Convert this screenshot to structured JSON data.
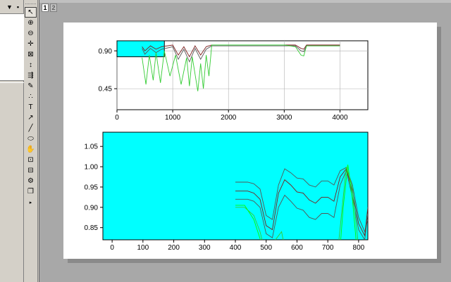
{
  "project_panel": {
    "header_icons": [
      "dropdown-icon",
      "pin-icon",
      "close-icon"
    ]
  },
  "toolbar": {
    "tools": [
      "pointer-icon",
      "zoom-in-icon",
      "zoom-out-icon",
      "screen-reader-icon",
      "data-selector-icon",
      "data-reader-icon",
      "mask-icon",
      "data-draw-icon",
      "scatter-tool-icon",
      "text-tool-icon",
      "arrow-tool-icon",
      "line-tool-icon",
      "shape-tool-icon",
      "hand-tool-icon",
      "rescale-icon",
      "region-icon",
      "settings-icon",
      "layers-icon",
      "more-icon"
    ]
  },
  "layers": [
    "1",
    "2"
  ],
  "colors": {
    "plot_fill": "#00ffff",
    "dark_red": "#7a1c1c",
    "gray_line": "#555555",
    "green_line": "#33cc33",
    "bright_green": "#00ff00"
  },
  "chart_data": [
    {
      "type": "line",
      "x_ticks": [
        "0",
        "1000",
        "2000",
        "3000",
        "4000"
      ],
      "y_ticks": [
        "0.45",
        "0.90"
      ],
      "xlim": [
        0,
        4500
      ],
      "ylim": [
        0.2,
        1.02
      ],
      "series": [
        {
          "color": "dark-red",
          "x": [
            450,
            500,
            600,
            700,
            800,
            1000,
            1100,
            1200,
            1300,
            1400,
            1500,
            1600,
            1700,
            1800,
            2000,
            2500,
            3000,
            3200,
            3300,
            3350,
            3400,
            4000
          ],
          "y": [
            0.95,
            0.9,
            0.96,
            0.92,
            0.95,
            0.97,
            0.85,
            0.95,
            0.83,
            0.96,
            0.85,
            0.95,
            0.97,
            0.97,
            0.97,
            0.97,
            0.97,
            0.97,
            0.93,
            0.92,
            0.97,
            0.97
          ]
        },
        {
          "color": "gray",
          "x": [
            450,
            500,
            600,
            700,
            800,
            1000,
            1100,
            1200,
            1300,
            1400,
            1500,
            1600,
            1700,
            1800,
            2000,
            2500,
            3000,
            3200,
            3300,
            3350,
            3400,
            4000
          ],
          "y": [
            0.93,
            0.86,
            0.93,
            0.88,
            0.92,
            0.95,
            0.8,
            0.92,
            0.77,
            0.93,
            0.8,
            0.92,
            0.96,
            0.96,
            0.96,
            0.96,
            0.96,
            0.96,
            0.9,
            0.89,
            0.96,
            0.96
          ]
        },
        {
          "color": "green",
          "x": [
            450,
            520,
            580,
            650,
            700,
            780,
            850,
            950,
            1050,
            1150,
            1250,
            1300,
            1350,
            1450,
            1500,
            1550,
            1600,
            1650,
            1700,
            1800,
            2000,
            3000,
            3200,
            3300,
            3350,
            3400,
            4000
          ],
          "y": [
            0.82,
            0.5,
            0.85,
            0.55,
            0.88,
            0.52,
            0.9,
            0.6,
            0.85,
            0.5,
            0.82,
            0.48,
            0.83,
            0.42,
            0.75,
            0.45,
            0.85,
            0.6,
            0.97,
            0.97,
            0.97,
            0.97,
            0.95,
            0.85,
            0.84,
            0.96,
            0.96
          ]
        }
      ],
      "selection_box": {
        "x": [
          0,
          850
        ],
        "y": [
          0.83,
          1.02
        ]
      }
    },
    {
      "type": "line",
      "x_ticks": [
        "0",
        "100",
        "200",
        "300",
        "400",
        "500",
        "600",
        "700",
        "800"
      ],
      "y_ticks": [
        "0.85",
        "0.90",
        "0.95",
        "1.00",
        "1.05"
      ],
      "xlim": [
        -30,
        830
      ],
      "ylim": [
        0.82,
        1.085
      ],
      "series": [
        {
          "color": "gray",
          "x": [
            400,
            440,
            460,
            480,
            500,
            520,
            540,
            560,
            580,
            600,
            620,
            640,
            660,
            680,
            700,
            720,
            740,
            760,
            780,
            800,
            820,
            830
          ],
          "y": [
            0.962,
            0.962,
            0.958,
            0.945,
            0.88,
            0.87,
            0.955,
            0.995,
            0.985,
            0.972,
            0.97,
            0.955,
            0.95,
            0.965,
            0.965,
            0.955,
            0.99,
            0.998,
            0.955,
            0.875,
            0.84,
            0.87
          ]
        },
        {
          "color": "dark-red",
          "x": [
            400,
            440,
            460,
            480,
            500,
            520,
            540,
            560,
            580,
            600,
            620,
            640,
            660,
            680,
            700,
            720,
            740,
            760,
            780,
            800,
            820,
            830
          ],
          "y": [
            0.94,
            0.94,
            0.935,
            0.92,
            0.855,
            0.845,
            0.935,
            0.968,
            0.955,
            0.938,
            0.935,
            0.918,
            0.91,
            0.925,
            0.925,
            0.915,
            0.975,
            0.995,
            0.94,
            0.86,
            0.83,
            0.9
          ]
        },
        {
          "color": "gray",
          "x": [
            400,
            440,
            460,
            480,
            500,
            520,
            540,
            560,
            580,
            600,
            620,
            640,
            660,
            680,
            700,
            720,
            740,
            760,
            780,
            800,
            820,
            830
          ],
          "y": [
            0.92,
            0.92,
            0.915,
            0.9,
            0.835,
            0.825,
            0.9,
            0.93,
            0.915,
            0.898,
            0.893,
            0.875,
            0.87,
            0.885,
            0.885,
            0.875,
            0.955,
            0.99,
            0.925,
            0.845,
            0.82,
            0.885
          ]
        },
        {
          "color": "green",
          "x": [
            400,
            430,
            460,
            480,
            500,
            510,
            530,
            550,
            560,
            580,
            720,
            740,
            760,
            780,
            800,
            820
          ],
          "y": [
            0.9,
            0.9,
            0.88,
            0.84,
            0.78,
            0.76,
            0.82,
            0.84,
            0.8,
            0.7,
            0.7,
            0.85,
            1.0,
            0.95,
            0.8,
            0.7
          ]
        },
        {
          "color": "bright-green",
          "x": [
            400,
            430,
            460,
            490,
            510,
            540,
            570,
            730,
            750,
            765,
            780,
            800
          ],
          "y": [
            0.905,
            0.905,
            0.87,
            0.8,
            0.74,
            0.8,
            0.7,
            0.7,
            0.9,
            1.005,
            0.92,
            0.75
          ]
        }
      ]
    }
  ]
}
